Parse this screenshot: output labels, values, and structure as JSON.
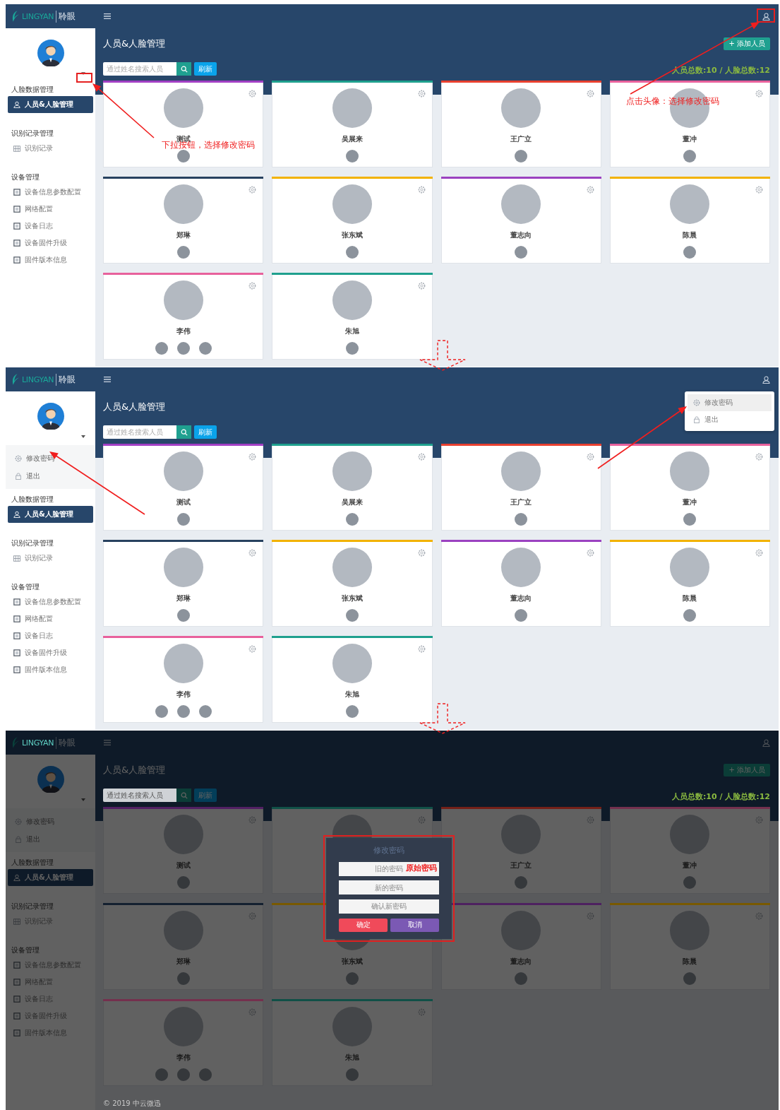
{
  "panels": [
    {
      "header": {
        "logo_mark": "LINGYAN",
        "logo_name": "聆眼"
      },
      "sidebar": {
        "user_menu": {
          "expanded": false
        },
        "sections": [
          {
            "title": "人脸数据管理",
            "items": [
              {
                "label": "人员&人脸管理",
                "selected": true
              }
            ]
          },
          {
            "title": "识别记录管理",
            "items": [
              {
                "label": "识别记录",
                "selected": false
              }
            ]
          },
          {
            "title": "设备管理",
            "items": [
              {
                "label": "设备信息参数配置",
                "selected": false
              },
              {
                "label": "网络配置",
                "selected": false
              },
              {
                "label": "设备日志",
                "selected": false
              },
              {
                "label": "设备固件升级",
                "selected": false
              },
              {
                "label": "固件版本信息",
                "selected": false
              }
            ]
          }
        ]
      },
      "main": {
        "title": "人员&人脸管理",
        "add_button": "+ 添加人员",
        "search": {
          "placeholder": "通过姓名搜索人员"
        },
        "refresh_button": "刷新",
        "totals": "人员总数:10 / 人脸总数:12",
        "cards": [
          {
            "name": "测试",
            "color": "#a23fc4",
            "faces": [
              {
                "kind": "photo"
              }
            ]
          },
          {
            "name": "吴展来",
            "color": "#1fa08e",
            "faces": [
              {
                "kind": "photo"
              }
            ]
          },
          {
            "name": "王广立",
            "color": "#e8402f",
            "faces": [
              {
                "kind": "photo"
              }
            ]
          },
          {
            "name": "董冲",
            "color": "#e8619c",
            "faces": [
              {
                "kind": "photo"
              }
            ]
          },
          {
            "name": "郑琳",
            "color": "#27415f",
            "faces": [
              {
                "kind": "photo"
              }
            ]
          },
          {
            "name": "张东斌",
            "color": "#f2b200",
            "faces": [
              {
                "kind": "photo"
              }
            ]
          },
          {
            "name": "董志向",
            "color": "#9b42c0",
            "faces": [
              {
                "kind": "photo"
              }
            ]
          },
          {
            "name": "陈晨",
            "color": "#f2b200",
            "faces": [
              {
                "kind": "photo"
              }
            ]
          },
          {
            "name": "李伟",
            "color": "#e8619c",
            "faces": [
              {
                "kind": "photo"
              },
              {
                "kind": "photo"
              },
              {
                "kind": "photo"
              }
            ]
          },
          {
            "name": "朱旭",
            "color": "#1fa08e",
            "faces": [
              {
                "kind": "photo"
              }
            ]
          }
        ]
      },
      "annotations": [
        {
          "kind": "caret-box"
        },
        {
          "kind": "caret-callout",
          "text": "下拉按钮，选择修改密码"
        },
        {
          "kind": "user-box"
        },
        {
          "kind": "user-callout",
          "text": "点击头像：选择修改密码"
        },
        {
          "kind": "next-arrow"
        }
      ]
    },
    {
      "header": {
        "logo_mark": "LINGYAN",
        "logo_name": "聆眼"
      },
      "sidebar": {
        "user_menu": {
          "expanded": true,
          "items": [
            {
              "label": "修改密码"
            },
            {
              "label": "退出"
            }
          ]
        },
        "sections": [
          {
            "title": "人脸数据管理",
            "items": [
              {
                "label": "人员&人脸管理",
                "selected": true
              }
            ]
          },
          {
            "title": "识别记录管理",
            "items": [
              {
                "label": "识别记录",
                "selected": false
              }
            ]
          },
          {
            "title": "设备管理",
            "items": [
              {
                "label": "设备信息参数配置",
                "selected": false
              },
              {
                "label": "网络配置",
                "selected": false
              },
              {
                "label": "设备日志",
                "selected": false
              },
              {
                "label": "设备固件升级",
                "selected": false
              },
              {
                "label": "固件版本信息",
                "selected": false
              }
            ]
          }
        ]
      },
      "account_menu": {
        "items": [
          {
            "label": "修改密码",
            "selected": true
          },
          {
            "label": "退出",
            "selected": false
          }
        ]
      },
      "main": {
        "title": "人员&人脸管理",
        "search": {
          "placeholder": "通过姓名搜索人员"
        },
        "refresh_button": "刷新",
        "cards": [
          {
            "name": "测试",
            "color": "#a23fc4",
            "faces": [
              {
                "kind": "photo"
              }
            ]
          },
          {
            "name": "吴展来",
            "color": "#1fa08e",
            "faces": [
              {
                "kind": "photo"
              }
            ]
          },
          {
            "name": "王广立",
            "color": "#e8402f",
            "faces": [
              {
                "kind": "photo"
              }
            ]
          },
          {
            "name": "董冲",
            "color": "#e8619c",
            "faces": [
              {
                "kind": "photo"
              }
            ]
          },
          {
            "name": "郑琳",
            "color": "#27415f",
            "faces": [
              {
                "kind": "photo"
              }
            ]
          },
          {
            "name": "张东斌",
            "color": "#f2b200",
            "faces": [
              {
                "kind": "photo"
              }
            ]
          },
          {
            "name": "董志向",
            "color": "#9b42c0",
            "faces": [
              {
                "kind": "photo"
              }
            ]
          },
          {
            "name": "陈晨",
            "color": "#f2b200",
            "faces": [
              {
                "kind": "photo"
              }
            ]
          },
          {
            "name": "李伟",
            "color": "#e8619c",
            "faces": [
              {
                "kind": "photo"
              },
              {
                "kind": "photo"
              },
              {
                "kind": "photo"
              }
            ]
          },
          {
            "name": "朱旭",
            "color": "#1fa08e",
            "faces": [
              {
                "kind": "photo"
              }
            ]
          }
        ]
      },
      "annotations": [
        {
          "kind": "menu-arrow"
        },
        {
          "kind": "account-arrow"
        },
        {
          "kind": "next-arrow"
        }
      ]
    },
    {
      "header": {
        "logo_mark": "LINGYAN",
        "logo_name": "聆眼"
      },
      "sidebar": {
        "user_menu": {
          "expanded": true,
          "items": [
            {
              "label": "修改密码"
            },
            {
              "label": "退出"
            }
          ]
        },
        "sections": [
          {
            "title": "人脸数据管理",
            "items": [
              {
                "label": "人员&人脸管理",
                "selected": true
              }
            ]
          },
          {
            "title": "识别记录管理",
            "items": [
              {
                "label": "识别记录",
                "selected": false
              }
            ]
          },
          {
            "title": "设备管理",
            "items": [
              {
                "label": "设备信息参数配置",
                "selected": false
              },
              {
                "label": "网络配置",
                "selected": false
              },
              {
                "label": "设备日志",
                "selected": false
              },
              {
                "label": "设备固件升级",
                "selected": false
              },
              {
                "label": "固件版本信息",
                "selected": false
              }
            ]
          }
        ]
      },
      "main": {
        "title": "人员&人脸管理",
        "add_button": "+ 添加人员",
        "search": {
          "placeholder": "通过姓名搜索人员"
        },
        "refresh_button": "刷新",
        "totals": "人员总数:10 / 人脸总数:12",
        "cards": [
          {
            "name": "测试",
            "color": "#511f62",
            "faces": [
              {
                "kind": "photo"
              }
            ]
          },
          {
            "color": "#105047"
          },
          {
            "name": "王广立",
            "color": "#742018",
            "faces": [
              {
                "kind": "photo"
              }
            ]
          },
          {
            "name": "董冲",
            "color": "#74304e",
            "faces": [
              {
                "kind": "photo"
              }
            ]
          },
          {
            "name": "郑琳",
            "color": "#142030",
            "faces": [
              {
                "kind": "photo"
              }
            ]
          },
          {
            "name": "张东斌",
            "color": "#795900",
            "faces": [
              {
                "kind": "photo"
              }
            ]
          },
          {
            "name": "董志向",
            "color": "#4e2160",
            "faces": [
              {
                "kind": "photo"
              }
            ]
          },
          {
            "name": "陈晨",
            "color": "#795900",
            "faces": [
              {
                "kind": "photo"
              }
            ]
          },
          {
            "name": "李伟",
            "color": "#74304e",
            "faces": [
              {
                "kind": "photo"
              },
              {
                "kind": "photo"
              },
              {
                "kind": "photo"
              }
            ]
          },
          {
            "name": "朱旭",
            "color": "#105047",
            "faces": [
              {
                "kind": "photo"
              }
            ]
          }
        ],
        "footer": "© 2019 中云微迅"
      },
      "dimmed": true,
      "modal": {
        "title": "修改密码",
        "fields": [
          {
            "placeholder": "旧的密码"
          },
          {
            "placeholder": "新的密码"
          },
          {
            "placeholder": "确认新密码"
          }
        ],
        "confirm": "确定",
        "cancel": "取消"
      },
      "annotations": [
        {
          "kind": "modal-box"
        },
        {
          "kind": "field-callout",
          "text": "原始密码"
        }
      ]
    }
  ]
}
